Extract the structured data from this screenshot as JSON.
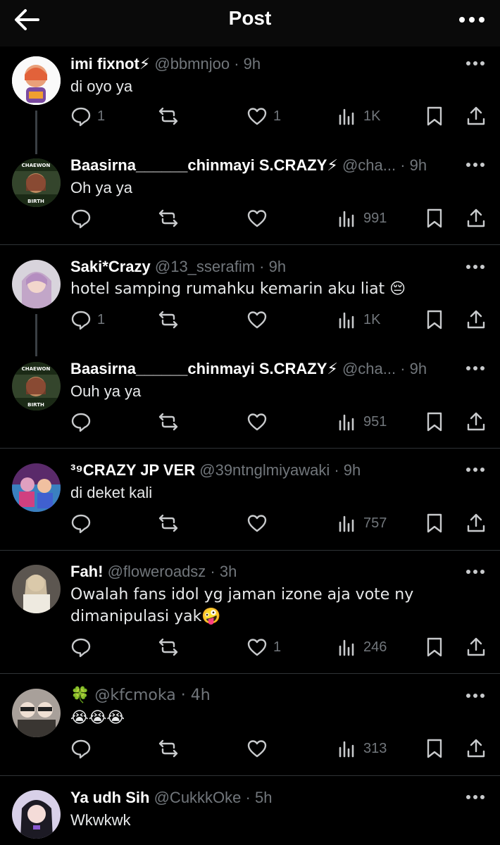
{
  "header": {
    "title": "Post"
  },
  "posts": [
    {
      "name": "imi fixnot⚡",
      "handle": "@bbmnjoo",
      "time": "9h",
      "text": "di oyo ya",
      "replies": "1",
      "retweets": "",
      "likes": "1",
      "views": "1K"
    },
    {
      "name": "Baasirna______chinmayi S.CRAZY⚡",
      "handle": "@cha...",
      "time": "9h",
      "text": "Oh ya ya",
      "replies": "",
      "retweets": "",
      "likes": "",
      "views": "991",
      "avatar_top": "CHAEWON",
      "avatar_bottom": "BIRTH"
    },
    {
      "name": "Saki*Crazy",
      "handle": "@13_sserafim",
      "time": "9h",
      "text": "hotel samping rumahku kemarin aku liat 😔",
      "replies": "1",
      "retweets": "",
      "likes": "",
      "views": "1K"
    },
    {
      "name": "Baasirna______chinmayi S.CRAZY⚡",
      "handle": "@cha...",
      "time": "9h",
      "text": "Ouh ya ya",
      "replies": "",
      "retweets": "",
      "likes": "",
      "views": "951",
      "avatar_top": "CHAEWON",
      "avatar_bottom": "BIRTH"
    },
    {
      "name": "³⁹CRAZY JP VER",
      "handle": "@39ntnglmiyawaki",
      "time": "9h",
      "text": "di deket kali",
      "replies": "",
      "retweets": "",
      "likes": "",
      "views": "757"
    },
    {
      "name": "Fah!",
      "handle": "@floweroadsz",
      "time": "3h",
      "text": "Owalah fans idol yg jaman izone aja vote ny dimanipulasi yak🤪",
      "replies": "",
      "retweets": "",
      "likes": "1",
      "views": "246"
    },
    {
      "name": "🍀",
      "handle": "@kfcmoka",
      "time": "4h",
      "text": "😭😭😭",
      "replies": "",
      "retweets": "",
      "likes": "",
      "views": "313"
    },
    {
      "name": "Ya udh Sih",
      "handle": "@CukkkOke",
      "time": "5h",
      "text": "Wkwkwk",
      "replies": "",
      "retweets": "",
      "likes": "",
      "views": ""
    }
  ],
  "colors": {
    "background": "#000000",
    "text": "#e7e9ea",
    "muted": "#71767b",
    "divider": "#2f3336"
  }
}
